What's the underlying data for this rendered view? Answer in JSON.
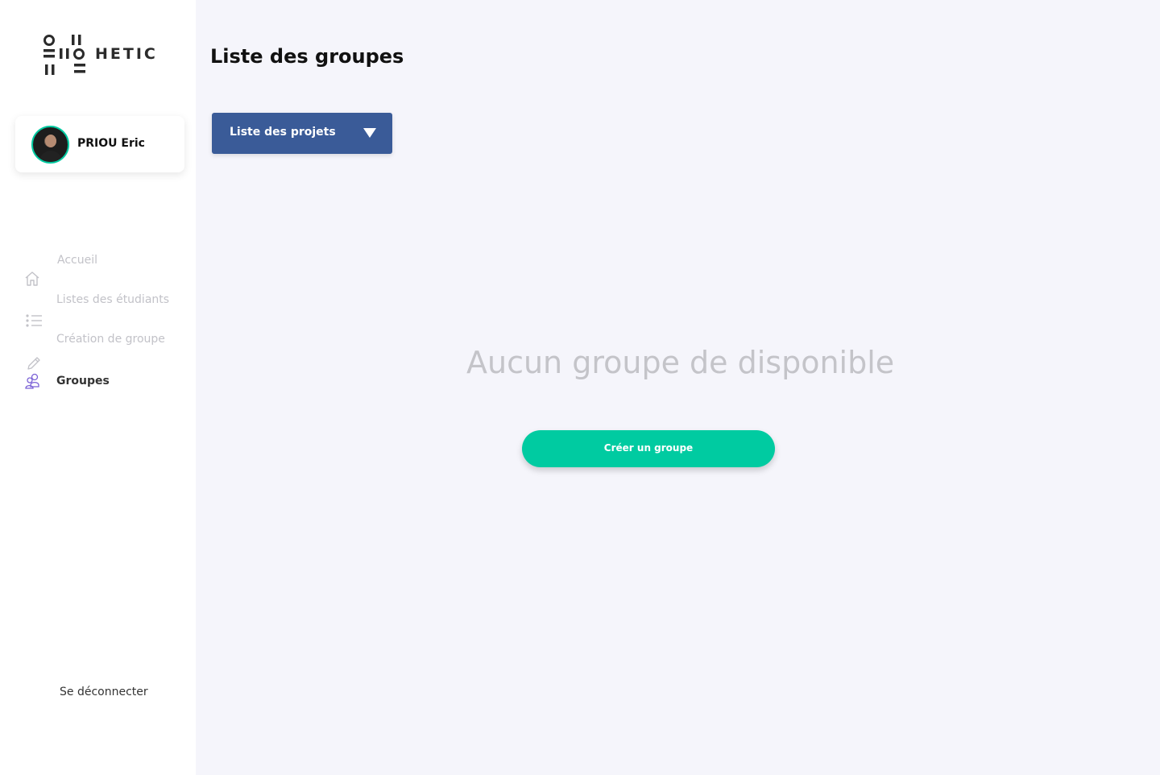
{
  "brand": {
    "name": "HETIC"
  },
  "profile": {
    "name": "PRIOU Eric"
  },
  "nav": [
    {
      "label": "Accueil",
      "icon": "home-icon",
      "active": false
    },
    {
      "label": "Listes des étudiants",
      "icon": "list-icon",
      "active": false
    },
    {
      "label": "Création de groupe",
      "icon": "pencil-icon",
      "active": false
    },
    {
      "label": "Groupes",
      "icon": "users-icon",
      "active": true
    }
  ],
  "logout_label": "Se déconnecter",
  "main": {
    "title": "Liste des groupes",
    "dropdown": {
      "selected": "Liste des projets"
    },
    "empty_message": "Aucun groupe de disponible",
    "create_button": "Créer un groupe"
  },
  "colors": {
    "accent": "#00cba1",
    "primary": "#3a5b98",
    "background": "#f5f5fb",
    "active_icon": "#7b62d6"
  }
}
